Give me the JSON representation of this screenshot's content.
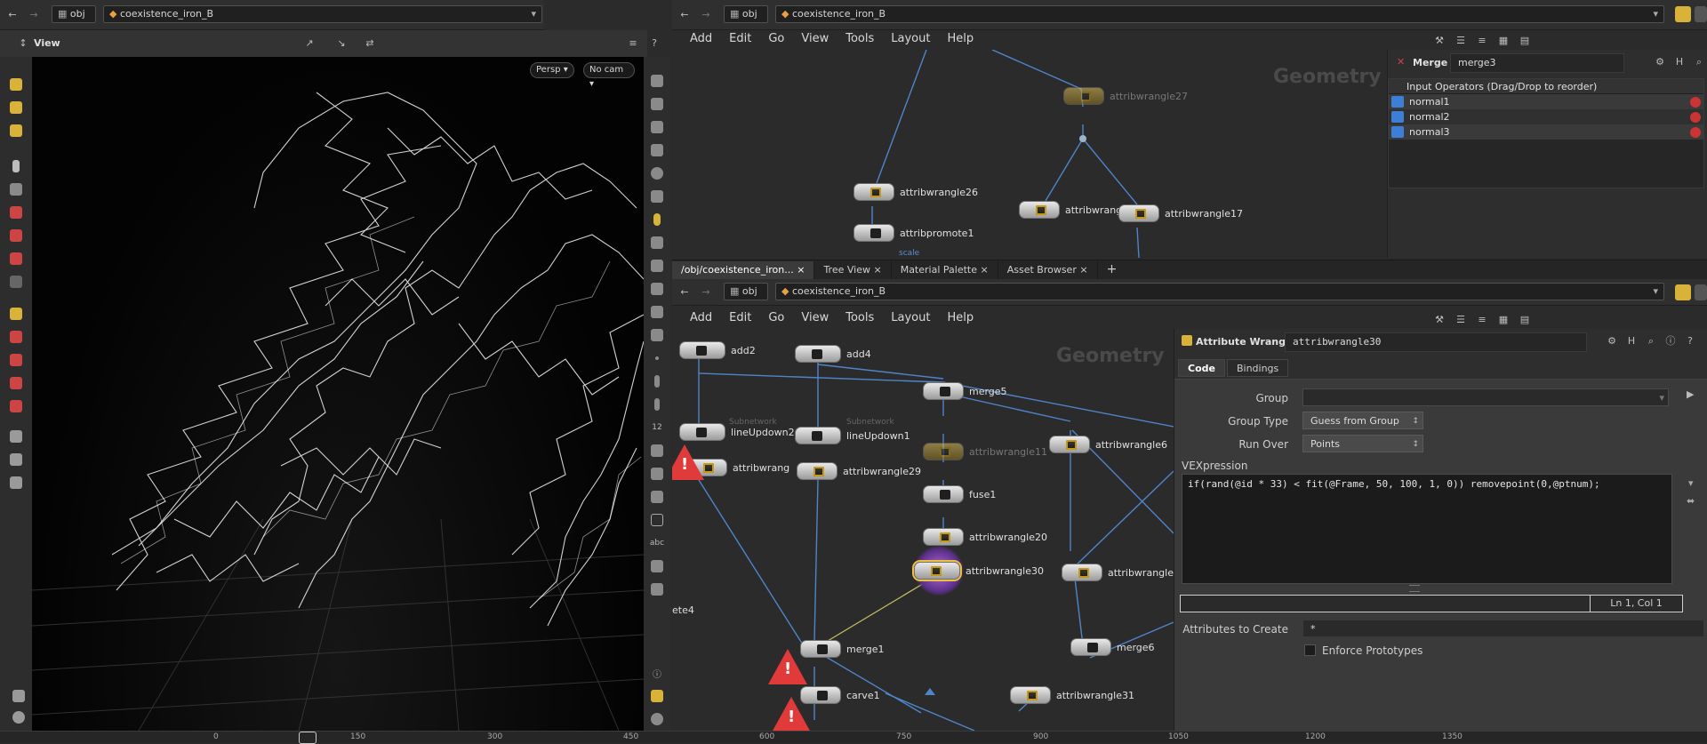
{
  "viewport": {
    "path_root": "obj",
    "path_node": "coexistence_iron_B",
    "title": "View",
    "persp_button": "Persp",
    "cam_button": "No cam",
    "timeline_ticks": [
      "0",
      "150",
      "300",
      "450",
      "600",
      "750",
      "900",
      "1050",
      "1200",
      "1350"
    ]
  },
  "network_top": {
    "path_root": "obj",
    "path_node": "coexistence_iron_B",
    "menu": [
      "Add",
      "Edit",
      "Go",
      "View",
      "Tools",
      "Layout",
      "Help"
    ],
    "context_label": "Geometry",
    "nodes": [
      {
        "name": "attribwrangle27"
      },
      {
        "name": "attribwrangle26"
      },
      {
        "name": "attribpromote1"
      },
      {
        "name": "attribwrangle1"
      },
      {
        "name": "attribwrangle17"
      }
    ],
    "sublabel_scale": "scale"
  },
  "merge_params": {
    "type_label": "Merge",
    "node_name": "merge3",
    "list_header": "Input Operators (Drag/Drop to reorder)",
    "inputs": [
      "normal1",
      "normal2",
      "normal3"
    ]
  },
  "pane_tabs": [
    "/obj/coexistence_iron...",
    "Tree View",
    "Material Palette",
    "Asset Browser"
  ],
  "network_bottom": {
    "path_root": "obj",
    "path_node": "coexistence_iron_B",
    "menu": [
      "Add",
      "Edit",
      "Go",
      "View",
      "Tools",
      "Layout",
      "Help"
    ],
    "context_label": "Geometry",
    "nodes": [
      {
        "name": "add2"
      },
      {
        "name": "add4"
      },
      {
        "name": "merge5"
      },
      {
        "name": "lineUpdown2",
        "sub": "Subnetwork"
      },
      {
        "name": "lineUpdown1",
        "sub": "Subnetwork"
      },
      {
        "name": "attribwrangle11"
      },
      {
        "name": "attribwrangle6"
      },
      {
        "name": "attribwrang"
      },
      {
        "name": "attribwrangle29"
      },
      {
        "name": "fuse1"
      },
      {
        "name": "attribwrangle20"
      },
      {
        "name": "attribwrangle30"
      },
      {
        "name": "attribwrangle"
      },
      {
        "name": "merge1"
      },
      {
        "name": "merge6"
      },
      {
        "name": "carve1"
      },
      {
        "name": "attribwrangle31"
      }
    ],
    "edge_label": "ete4"
  },
  "wrangle_params": {
    "type_label": "Attribute Wrangle",
    "node_name": "attribwrangle30",
    "tabs": [
      "Code",
      "Bindings"
    ],
    "group_label": "Group",
    "group_value": "",
    "group_type_label": "Group Type",
    "group_type_value": "Guess from Group",
    "run_over_label": "Run Over",
    "run_over_value": "Points",
    "vex_label": "VEXpression",
    "vex_code": "if(rand(@id * 33) < fit(@Frame, 50, 100, 1, 0)) removepoint(0,@ptnum);",
    "cursor_pos": "Ln 1, Col 1",
    "attrs_label": "Attributes to Create",
    "attrs_value": "*",
    "enforce_label": "Enforce Prototypes"
  },
  "colors": {
    "accent": "#f0c040",
    "warning": "#e03a3a",
    "wire": "#4f84c9"
  }
}
